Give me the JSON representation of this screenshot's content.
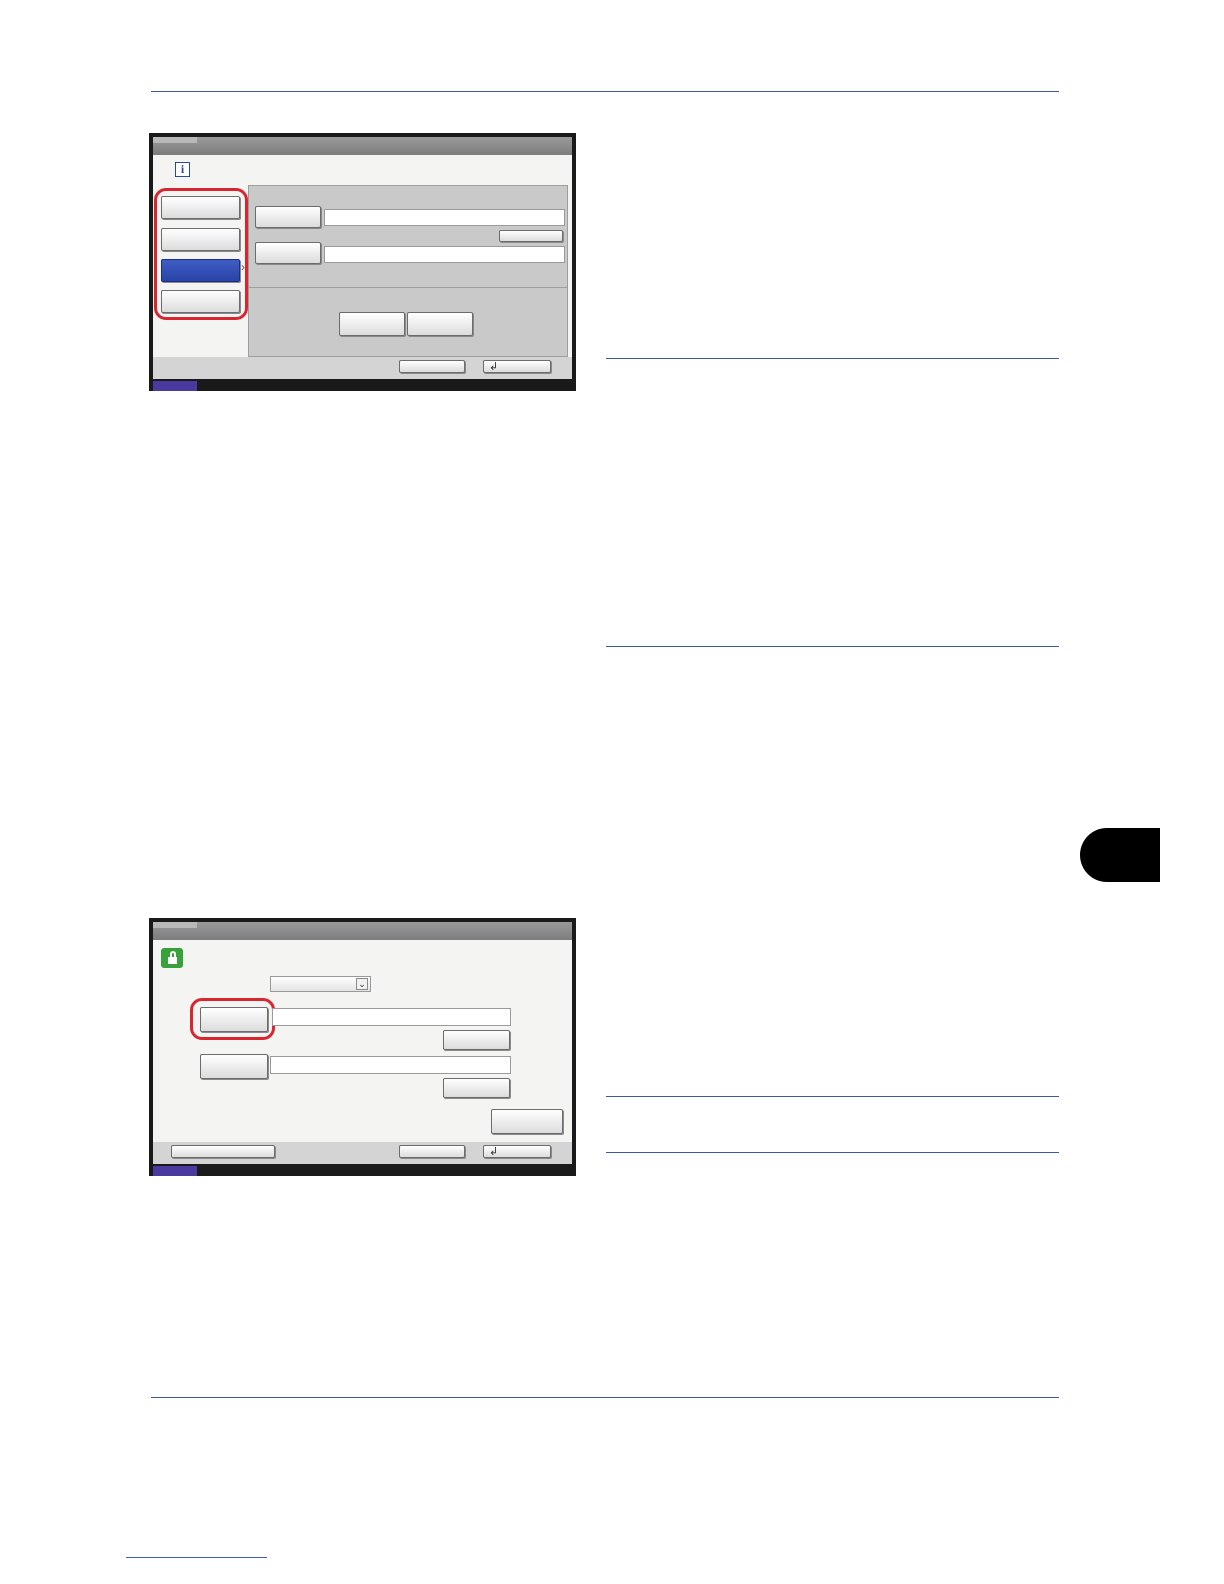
{
  "page": {
    "chapter_tab_color": "#000000",
    "rule_color": "#3a5a9a"
  },
  "screen1": {
    "info_icon_glyph": "i",
    "side_buttons": [
      "",
      "",
      "",
      ""
    ],
    "selected_side_index": 2,
    "selected_color": "#2e48ad",
    "field_buttons": [
      "",
      ""
    ],
    "action_buttons": [
      "",
      ""
    ],
    "bottom_buttons": [
      "",
      ""
    ],
    "enter_glyph": "↲",
    "highlight_color": "#d8262f"
  },
  "screen2": {
    "lock_icon_color": "#39a13a",
    "dropdown_value": "",
    "dropdown_glyph": "⌄",
    "field_buttons": [
      "",
      ""
    ],
    "small_buttons": [
      "",
      ""
    ],
    "right_button": "",
    "bottom_buttons": [
      "",
      "",
      ""
    ],
    "enter_glyph": "↲",
    "highlight_color": "#d8262f"
  }
}
